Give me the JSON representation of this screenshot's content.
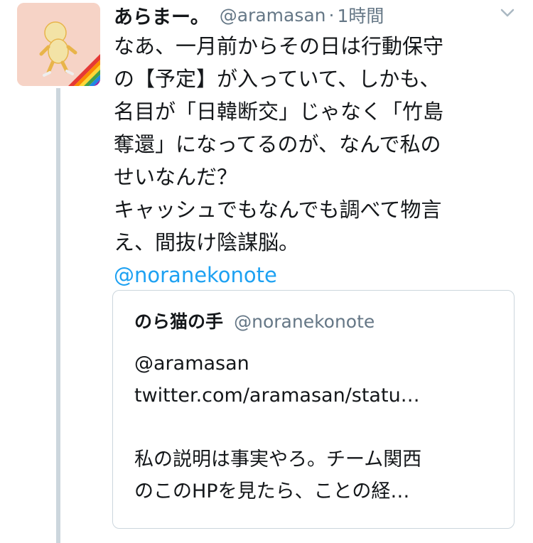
{
  "tweet": {
    "display_name": "あらまー。",
    "handle": "@aramasan",
    "separator": "·",
    "time": "1時間",
    "text_lines": [
      "なあ、一月前からその日は行動保守",
      "の【予定】が入っていて、しかも、",
      "名目が「日韓断交」じゃなく「竹島",
      "奪還」になってるのが、なんで私の",
      "せいなんだ？",
      "キャッシュでもなんでも調べて物言",
      "え、間抜け陰謀脳。"
    ],
    "mention": "@noranekonote"
  },
  "quote": {
    "display_name": "のら猫の手",
    "handle": "@noranekonote",
    "text_lines": [
      "@aramasan",
      "twitter.com/aramasan/statu…",
      "",
      "私の説明は事実やろ。チーム関西",
      "のこのHPを見たら、ことの経…"
    ]
  },
  "icons": {
    "menu": "chevron-down-icon",
    "avatar": "avatar-image"
  },
  "colors": {
    "link": "#1da1f2",
    "muted": "#657786",
    "border": "#ccd6dd"
  }
}
